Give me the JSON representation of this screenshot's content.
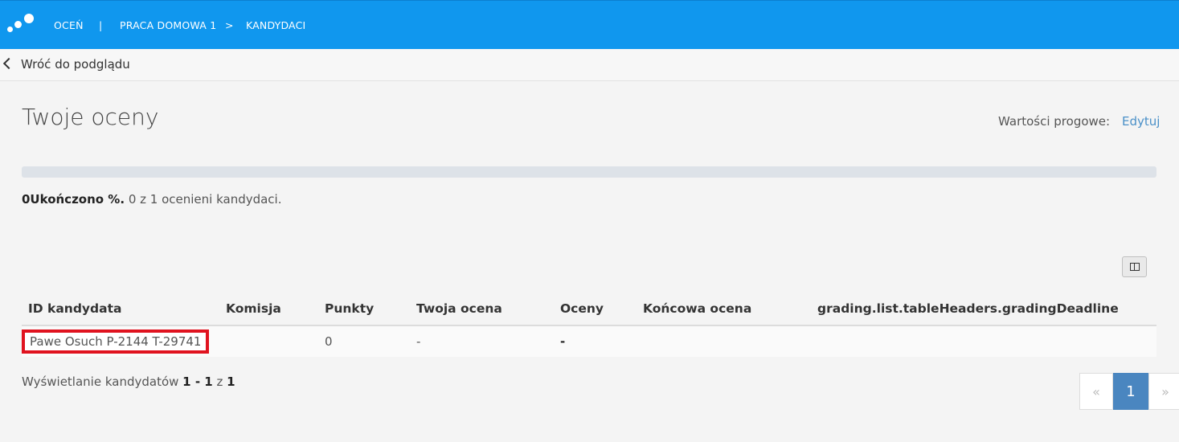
{
  "header": {
    "crumb_1": "OCEŃ",
    "separator": "|",
    "crumb_2": "PRACA DOMOWA 1",
    "arrow": ">",
    "crumb_3": "KANDYDACI"
  },
  "subbar": {
    "back_label": "Wróć do podglądu"
  },
  "page": {
    "title": "Twoje oceny",
    "thresholds_label": "Wartości progowe:",
    "thresholds_edit": "Edytuj"
  },
  "progress": {
    "percent": 0,
    "completed_bold": "0Ukończono %.",
    "completed_rest": " 0 z 1 ocenieni kandydaci."
  },
  "table": {
    "headers": [
      "ID kandydata",
      "Komisja",
      "Punkty",
      "Twoja ocena",
      "Oceny",
      "Końcowa ocena",
      "grading.list.tableHeaders.gradingDeadline"
    ],
    "rows": [
      [
        "Pawe Osuch P-2144 T-29741",
        "",
        "0",
        "-",
        "-",
        "",
        ""
      ]
    ]
  },
  "footer": {
    "showing_prefix": "Wyświetlanie kandydatów ",
    "range": "1 - 1",
    "of": " z ",
    "total": "1"
  },
  "pagination": {
    "prev": "«",
    "current": "1",
    "next": "»"
  },
  "colors": {
    "topbar": "#1097ee",
    "highlight": "#e0131f",
    "active_page": "#4a86c0"
  }
}
